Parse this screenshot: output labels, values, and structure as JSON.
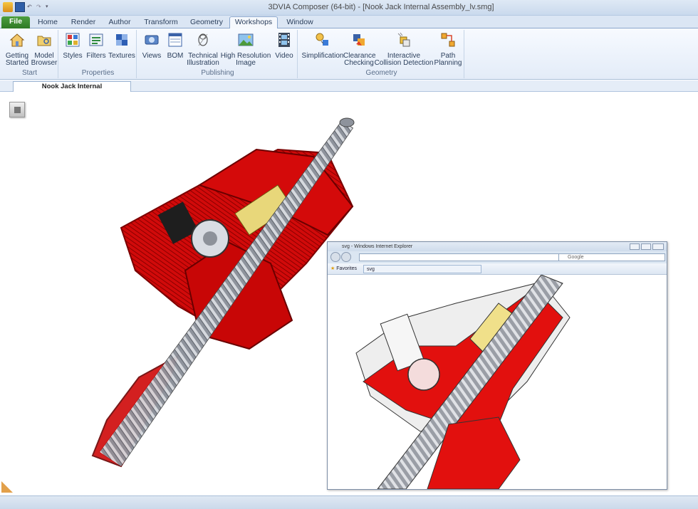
{
  "app": {
    "title": "3DVIA Composer (64-bit) - [Nook Jack Internal Assembly_lv.smg]"
  },
  "tabs": [
    "File",
    "Home",
    "Render",
    "Author",
    "Transform",
    "Geometry",
    "Workshops",
    "Window"
  ],
  "active_tab": "Workshops",
  "ribbon": {
    "groups": [
      {
        "label": "Start",
        "buttons": [
          "Getting Started",
          "Model Browser"
        ]
      },
      {
        "label": "Properties",
        "buttons": [
          "Styles",
          "Filters",
          "Textures"
        ]
      },
      {
        "label": "Publishing",
        "buttons": [
          "Views",
          "BOM",
          "Technical Illustration",
          "High Resolution Image",
          "Video"
        ]
      },
      {
        "label": "Geometry",
        "buttons": [
          "Simplification",
          "Clearance Checking",
          "Interactive Collision Detection",
          "Path Planning"
        ]
      }
    ],
    "start": {
      "label": "Start",
      "b1a": "Getting",
      "b1b": "Started",
      "b2a": "Model",
      "b2b": "Browser"
    },
    "properties": {
      "label": "Properties",
      "b1": "Styles",
      "b2": "Filters",
      "b3": "Textures"
    },
    "publishing": {
      "label": "Publishing",
      "b1": "Views",
      "b2": "BOM",
      "b3a": "Technical",
      "b3b": "Illustration",
      "b4a": "High Resolution",
      "b4b": "Image",
      "b5": "Video"
    },
    "geometry": {
      "label": "Geometry",
      "b1": "Simplification",
      "b2a": "Clearance",
      "b2b": "Checking",
      "b3a": "Interactive",
      "b3b": "Collision Detection",
      "b4a": "Path",
      "b4b": "Planning"
    }
  },
  "document_tab": "Nook Jack Internal Assembly_lv.smg",
  "browser": {
    "title": "svg - Windows Internet Explorer",
    "search_placeholder": "Google",
    "favorites": "Favorites",
    "page_tab": "svg"
  },
  "colors": {
    "housing_red": "#d10a0a",
    "screw_gray": "#9a9ea6",
    "brass": "#e8d77a",
    "ribbon_bg": "#e3ecf8",
    "file_tab": "#3d8c31"
  }
}
